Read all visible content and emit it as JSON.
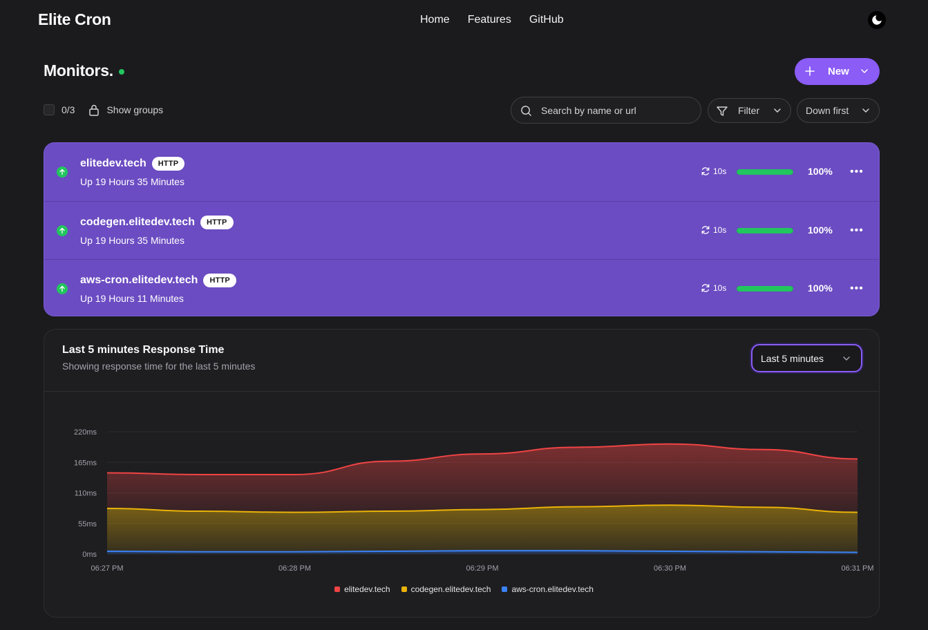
{
  "app": {
    "brand": "Elite Cron"
  },
  "nav": {
    "links": [
      "Home",
      "Features",
      "GitHub"
    ]
  },
  "page": {
    "title": "Monitors."
  },
  "actions": {
    "new_label": "New"
  },
  "toolbar": {
    "selection_count": "0/3",
    "show_groups_label": "Show groups",
    "search_placeholder": "Search by name or url",
    "filter_label": "Filter",
    "sort_label": "Down first"
  },
  "monitors": [
    {
      "name": "elitedev.tech",
      "type": "HTTP",
      "uptime": "Up 19 Hours 35 Minutes",
      "interval": "10s",
      "uptime_pct_label": "100%",
      "uptime_fraction": 1.0
    },
    {
      "name": "codegen.elitedev.tech",
      "type": "HTTP",
      "uptime": "Up 19 Hours 35 Minutes",
      "interval": "10s",
      "uptime_pct_label": "100%",
      "uptime_fraction": 1.0
    },
    {
      "name": "aws-cron.elitedev.tech",
      "type": "HTTP",
      "uptime": "Up 19 Hours 11 Minutes",
      "interval": "10s",
      "uptime_pct_label": "100%",
      "uptime_fraction": 1.0
    }
  ],
  "chart_card": {
    "title": "Last 5 minutes Response Time",
    "subtitle": "Showing response time for the last 5 minutes",
    "range_selected": "Last 5 minutes"
  },
  "colors": {
    "accent": "#8b5cf6",
    "status_up": "#22c55e",
    "series_1": "#ef4444",
    "series_2": "#eab308",
    "series_3": "#3b82f6"
  },
  "chart_data": {
    "type": "area",
    "stacked": true,
    "x": [
      "06:27 PM",
      "06:27:30 PM",
      "06:28 PM",
      "06:28:30 PM",
      "06:29 PM",
      "06:29:30 PM",
      "06:30 PM",
      "06:30:30 PM",
      "06:31 PM"
    ],
    "x_tick_labels": [
      "06:27 PM",
      "06:28 PM",
      "06:29 PM",
      "06:30 PM",
      "06:31 PM"
    ],
    "y_tick_labels": [
      "0ms",
      "55ms",
      "110ms",
      "165ms",
      "220ms"
    ],
    "ylim": [
      0,
      220
    ],
    "grid": true,
    "legend_position": "bottom-center",
    "series": [
      {
        "name": "aws-cron.elitedev.tech",
        "color": "#3b82f6",
        "values": [
          5,
          4,
          4,
          5,
          6,
          6,
          5,
          4,
          3
        ]
      },
      {
        "name": "codegen.elitedev.tech",
        "color": "#eab308",
        "values": [
          77,
          73,
          71,
          72,
          74,
          79,
          83,
          80,
          72
        ]
      },
      {
        "name": "elitedev.tech",
        "color": "#ef4444",
        "values": [
          64,
          66,
          68,
          90,
          100,
          107,
          110,
          104,
          96
        ]
      }
    ]
  }
}
